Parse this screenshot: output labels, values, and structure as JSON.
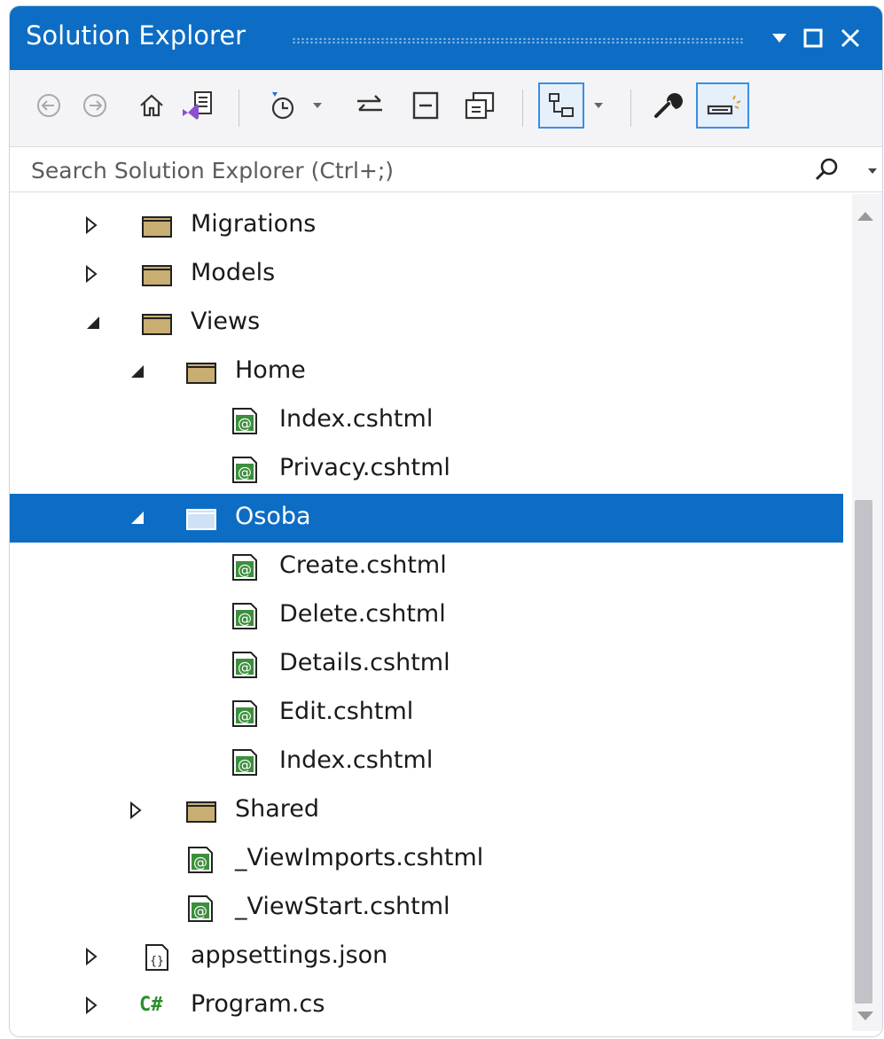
{
  "window": {
    "title": "Solution Explorer",
    "controls": {
      "dropdown_icon": "triangle-down-icon",
      "maximize_icon": "square-icon",
      "close_icon": "close-icon"
    }
  },
  "toolbar": {
    "items": [
      "back-icon",
      "forward-icon",
      "home-icon",
      "vs-project-icon",
      "pending-changes-filter-icon",
      "sync-with-active-document-icon",
      "collapse-all-icon",
      "show-all-files-icon",
      "preview-selected-items-icon",
      "properties-icon",
      "preview-selected-items-icon"
    ]
  },
  "search": {
    "placeholder": "Search Solution Explorer (Ctrl+;)"
  },
  "tree": {
    "items": [
      {
        "label": "Migrations",
        "type": "folder",
        "expanded": false
      },
      {
        "label": "Models",
        "type": "folder",
        "expanded": false
      },
      {
        "label": "Views",
        "type": "folder",
        "expanded": true
      },
      {
        "label": "Home",
        "type": "folder",
        "expanded": true
      },
      {
        "label": "Index.cshtml",
        "type": "cshtml"
      },
      {
        "label": "Privacy.cshtml",
        "type": "cshtml"
      },
      {
        "label": "Osoba",
        "type": "folder",
        "expanded": true,
        "selected": true
      },
      {
        "label": "Create.cshtml",
        "type": "cshtml"
      },
      {
        "label": "Delete.cshtml",
        "type": "cshtml"
      },
      {
        "label": "Details.cshtml",
        "type": "cshtml"
      },
      {
        "label": "Edit.cshtml",
        "type": "cshtml"
      },
      {
        "label": "Index.cshtml",
        "type": "cshtml"
      },
      {
        "label": "Shared",
        "type": "folder",
        "expanded": false
      },
      {
        "label": "_ViewImports.cshtml",
        "type": "cshtml"
      },
      {
        "label": "_ViewStart.cshtml",
        "type": "cshtml"
      },
      {
        "label": "appsettings.json",
        "type": "json"
      },
      {
        "label": "Program.cs",
        "type": "csharp"
      }
    ],
    "csharp_glyph": "C#"
  },
  "colors": {
    "accent": "#0d6dc4",
    "folder": "#c8ae72",
    "cshtml_green": "#3c8f3c"
  }
}
